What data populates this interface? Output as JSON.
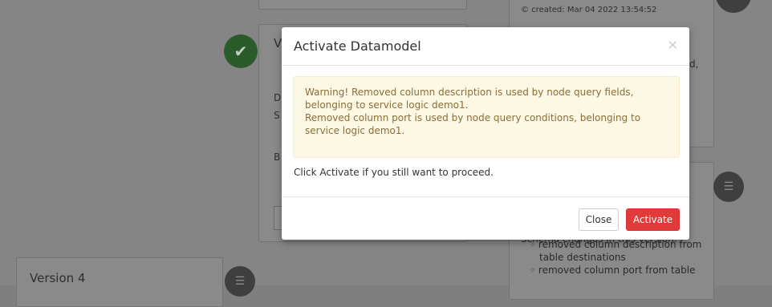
{
  "background": {
    "created_text": "© created: Mar 04 2022 13:54:52",
    "mid_card_title_fragment": "V",
    "mid_card_line1": "D",
    "mid_card_line2": "S",
    "mid_card_line3": "B",
    "right_card_fragment": "d,",
    "bullets_header": "Schema changes in this version:",
    "bullet_items": [
      "removed column description from",
      "table destinations",
      "removed column port from table"
    ],
    "left_card_title": "Version 4",
    "icons": {
      "check": "check-icon",
      "list": "list-icon"
    }
  },
  "modal": {
    "title": "Activate Datamodel",
    "close_glyph": "×",
    "warning_line1": "Warning! Removed column description is used by node query fields, belonging to service logic demo1.",
    "warning_line2": "Removed column port is used by node query conditions, belonging to service logic demo1.",
    "body_text": "Click Activate if you still want to proceed.",
    "buttons": {
      "close": "Close",
      "activate": "Activate"
    }
  },
  "colors": {
    "activate": "#e03a3a",
    "alert_bg": "#fcf8e3",
    "alert_text": "#8a6d3b",
    "success_circle": "#2b5a2b"
  }
}
